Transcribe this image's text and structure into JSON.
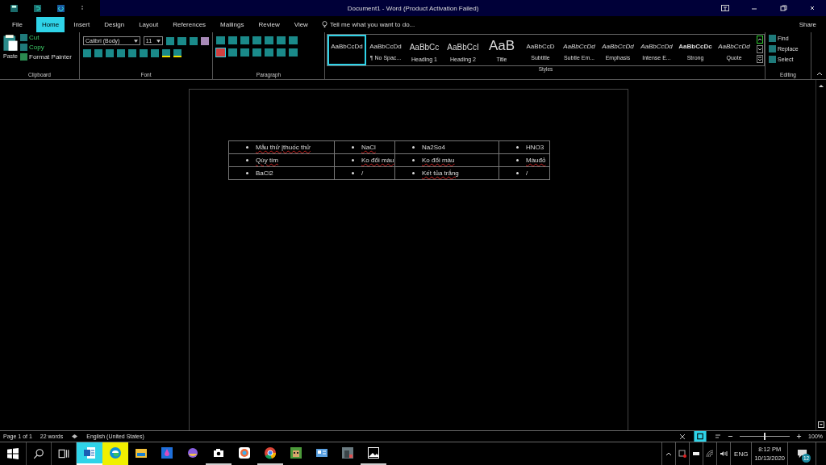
{
  "window": {
    "title": "Document1 - Word (Product Activation Failed)"
  },
  "tabs": [
    {
      "label": "File",
      "selected": false
    },
    {
      "label": "Home",
      "selected": true
    },
    {
      "label": "Insert",
      "selected": false
    },
    {
      "label": "Design",
      "selected": false
    },
    {
      "label": "Layout",
      "selected": false
    },
    {
      "label": "References",
      "selected": false
    },
    {
      "label": "Mailings",
      "selected": false
    },
    {
      "label": "Review",
      "selected": false
    },
    {
      "label": "View",
      "selected": false
    }
  ],
  "tell_me": {
    "placeholder": "Tell me what you want to do..."
  },
  "share": "Share",
  "clipboard": {
    "paste": "Paste",
    "items": [
      "Cut",
      "Copy",
      "Format Painter"
    ],
    "label": "Clipboard"
  },
  "font": {
    "name": "Calibri (Body)",
    "size": "11",
    "label": "Font"
  },
  "paragraph": {
    "label": "Paragraph"
  },
  "styles": {
    "label": "Styles",
    "items": [
      {
        "preview": "AaBbCcDd",
        "kind": "plain",
        "selected": true
      },
      {
        "preview": "AaBbCcDd",
        "name": "¶ No Spac...",
        "kind": "plain",
        "selected": false
      },
      {
        "preview": "AaBbCc",
        "name": "Heading 1",
        "kind": "heading",
        "selected": false
      },
      {
        "preview": "AaBbCcI",
        "name": "Heading 2",
        "kind": "heading",
        "selected": false
      },
      {
        "preview": "AaB",
        "name": "Title",
        "kind": "title",
        "selected": false
      },
      {
        "preview": "AaBbCcD",
        "name": "Subtitle",
        "kind": "plain",
        "selected": false
      },
      {
        "preview": "AaBbCcDd",
        "name": "Subtle Em...",
        "kind": "italic",
        "selected": false
      },
      {
        "preview": "AaBbCcDd",
        "name": "Emphasis",
        "kind": "italic",
        "selected": false
      },
      {
        "preview": "AaBbCcDd",
        "name": "Intense E...",
        "kind": "italic",
        "selected": false
      },
      {
        "preview": "AaBbCcDc",
        "name": "Strong",
        "kind": "bold",
        "selected": false
      },
      {
        "preview": "AaBbCcDd",
        "name": "Quote",
        "kind": "italic",
        "selected": false
      }
    ]
  },
  "editing": {
    "label": "Editing",
    "items": [
      "Find",
      "Replace",
      "Select"
    ]
  },
  "table": {
    "rows": [
      [
        {
          "text": "Mẫu thử |thuốc thử",
          "misspelled": true
        },
        {
          "text": "NaCl",
          "misspelled": true
        },
        {
          "text": "Na2So4",
          "misspelled": false
        },
        {
          "text": "HNO3",
          "misspelled": false
        }
      ],
      [
        {
          "text": "Qùy tím",
          "misspelled": true
        },
        {
          "text": "Ko đổi màu",
          "misspelled": true
        },
        {
          "text": "Ko đổi màu",
          "misspelled": true
        },
        {
          "text": "Màuđỏ",
          "misspelled": true
        }
      ],
      [
        {
          "text": "BaCl2",
          "misspelled": false
        },
        {
          "text": "/",
          "misspelled": false
        },
        {
          "text": "Kết tủa trắng",
          "misspelled": true
        },
        {
          "text": "/",
          "misspelled": false
        }
      ]
    ]
  },
  "status_bar": {
    "page": "Page 1 of 1",
    "words": "22 words",
    "language": "English (United States)",
    "zoom": "100%",
    "zoom_slider": {
      "level": 0.5
    }
  },
  "taskbar": {
    "apps": [
      {
        "kind": "word",
        "selected": true,
        "hovered": false,
        "running": false
      },
      {
        "kind": "edge",
        "selected": false,
        "hovered": true,
        "running": false
      },
      {
        "kind": "folder",
        "selected": false,
        "hovered": false,
        "running": false
      },
      {
        "kind": "drop",
        "selected": false,
        "hovered": false,
        "running": false
      },
      {
        "kind": "orb",
        "selected": false,
        "hovered": false,
        "running": false
      },
      {
        "kind": "camera",
        "selected": false,
        "hovered": false,
        "running": true
      },
      {
        "kind": "palette",
        "selected": false,
        "hovered": false,
        "running": false
      },
      {
        "kind": "chrome",
        "selected": false,
        "hovered": false,
        "running": true
      },
      {
        "kind": "game",
        "selected": false,
        "hovered": false,
        "running": false
      },
      {
        "kind": "card",
        "selected": false,
        "hovered": false,
        "running": false
      },
      {
        "kind": "photo",
        "selected": false,
        "hovered": false,
        "running": false
      },
      {
        "kind": "image",
        "selected": false,
        "hovered": false,
        "running": true
      }
    ],
    "language": "ENG",
    "time": "8:12 PM",
    "date": "10/13/2020",
    "notifications": "12"
  }
}
